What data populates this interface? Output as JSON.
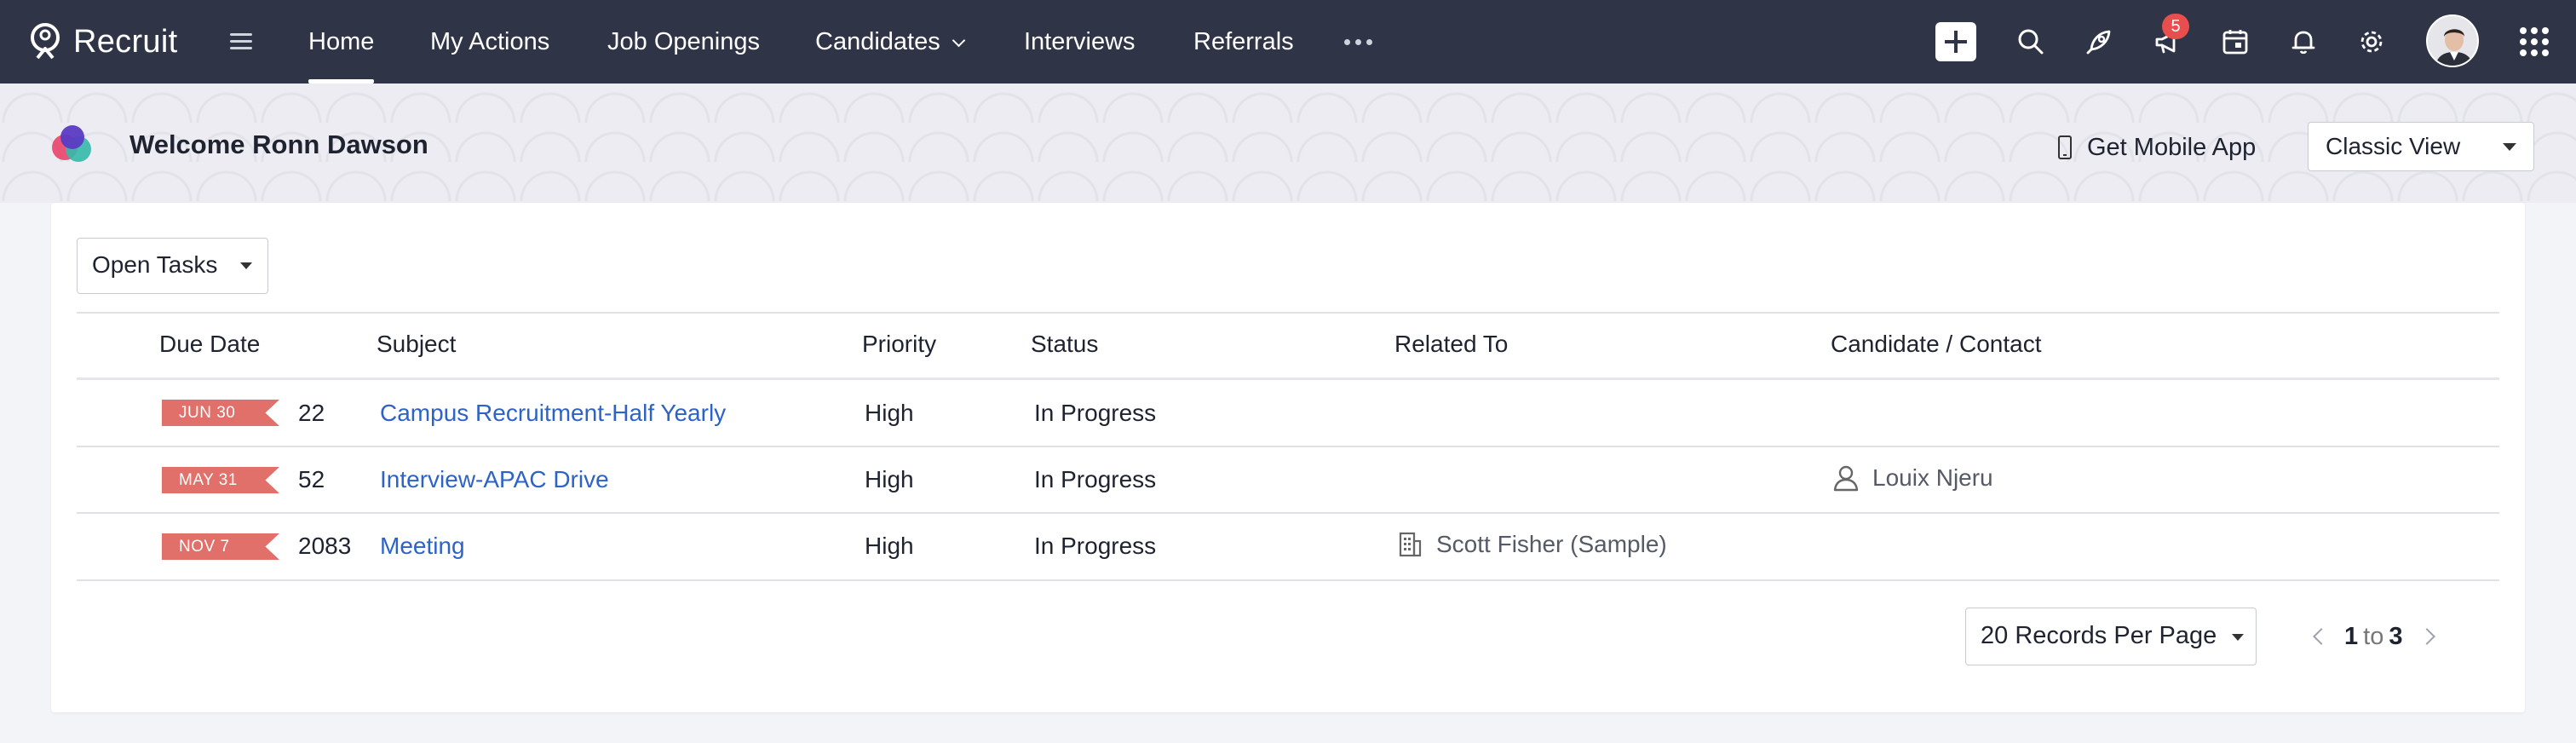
{
  "app": {
    "name": "Recruit"
  },
  "nav": {
    "items": [
      {
        "label": "Home",
        "active": true
      },
      {
        "label": "My Actions"
      },
      {
        "label": "Job Openings"
      },
      {
        "label": "Candidates",
        "has_dropdown": true
      },
      {
        "label": "Interviews"
      },
      {
        "label": "Referrals"
      }
    ],
    "more_icon": "more-horizontal-icon",
    "notification_count": "5",
    "icons": [
      "plus-icon",
      "search-icon",
      "rocket-icon",
      "megaphone-icon",
      "calendar-icon",
      "bell-icon",
      "gear-icon",
      "avatar",
      "apps-grid-icon"
    ]
  },
  "welcome": {
    "text": "Welcome Ronn Dawson",
    "mobile_app_label": "Get Mobile App",
    "view_select": "Classic View"
  },
  "tasks": {
    "filter": "Open Tasks",
    "columns": [
      "Due Date",
      "Subject",
      "Priority",
      "Status",
      "Related To",
      "Candidate / Contact"
    ],
    "rows": [
      {
        "date": "JUN 30",
        "days": "22",
        "subject": "Campus Recruitment-Half Yearly",
        "priority": "High",
        "status": "In Progress",
        "related_to": "",
        "contact": ""
      },
      {
        "date": "MAY 31",
        "days": "52",
        "subject": "Interview-APAC Drive",
        "priority": "High",
        "status": "In Progress",
        "related_to": "",
        "contact": "Louix Njeru"
      },
      {
        "date": "NOV 7",
        "days": "2083",
        "subject": "Meeting",
        "priority": "High",
        "status": "In Progress",
        "related_to": "Scott Fisher (Sample)",
        "contact": ""
      }
    ]
  },
  "pagination": {
    "per_page": "20 Records Per Page",
    "from": "1",
    "to_word": "to",
    "to": "3"
  },
  "colors": {
    "topbar": "#2f3446",
    "link": "#2d63c8",
    "date_tag": "#e07069",
    "badge": "#e84e4e"
  }
}
